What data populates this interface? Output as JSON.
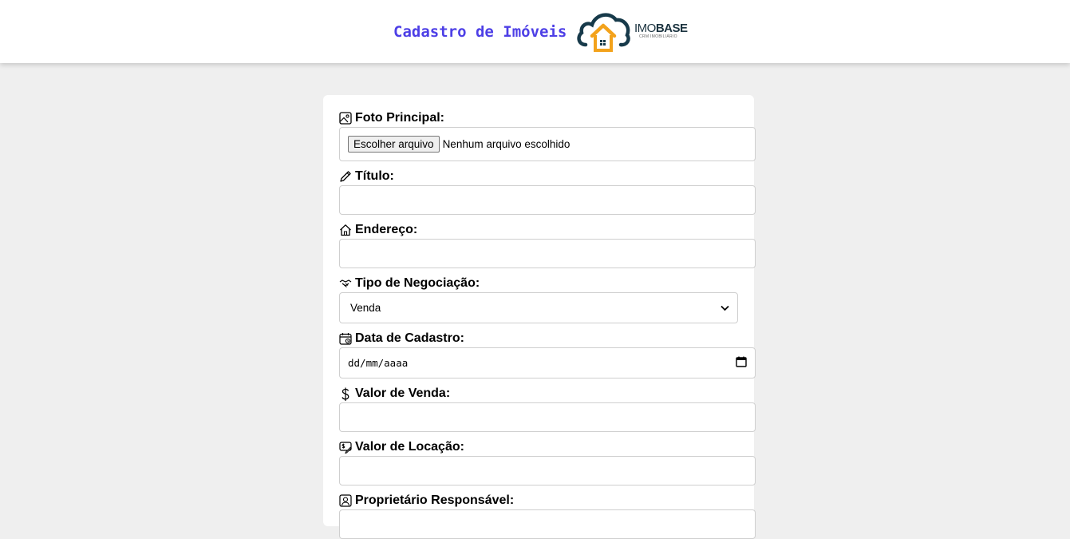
{
  "header": {
    "title": "Cadastro de Imóveis",
    "logo": {
      "word_light": "IMO",
      "word_bold": "BASE",
      "tagline": "CRM IMOBILIÁRIO"
    }
  },
  "form": {
    "foto": {
      "label": "Foto Principal:",
      "button_label": "Escolher arquivo",
      "status": "Nenhum arquivo escolhido",
      "icon": "image-icon"
    },
    "titulo": {
      "label": "Título:",
      "value": "",
      "icon": "pencil-icon"
    },
    "endereco": {
      "label": "Endereço:",
      "value": "",
      "icon": "house-icon"
    },
    "tipo": {
      "label": "Tipo de Negociação:",
      "selected": "Venda",
      "icon": "handshake-icon"
    },
    "data": {
      "label": "Data de Cadastro:",
      "placeholder": "dd/mm/aaaa",
      "icon": "calendar-icon"
    },
    "valor_venda": {
      "label": "Valor de Venda:",
      "value": "",
      "icon": "dollar-icon"
    },
    "valor_locacao": {
      "label": "Valor de Locação:",
      "value": "",
      "icon": "cash-icon"
    },
    "proprietario": {
      "label": "Proprietário Responsável:",
      "icon": "person-badge-icon"
    }
  },
  "colors": {
    "title": "#4d3fe6",
    "logo_dark": "#173a4a",
    "logo_accent": "#f3a21b",
    "background": "#efefef"
  }
}
